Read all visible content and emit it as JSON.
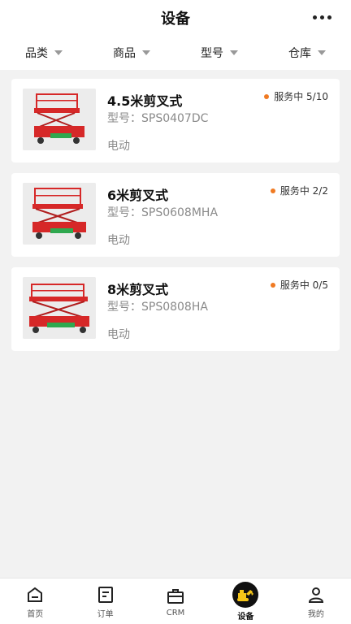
{
  "header": {
    "title": "设备"
  },
  "filters": [
    {
      "label": "品类"
    },
    {
      "label": "商品"
    },
    {
      "label": "型号"
    },
    {
      "label": "仓库"
    }
  ],
  "items": [
    {
      "name": "4.5米剪叉式",
      "model": "型号：SPS0407DC",
      "power": "电动",
      "status": "服务中 5/10"
    },
    {
      "name": "6米剪叉式",
      "model": "型号：SPS0608MHA",
      "power": "电动",
      "status": "服务中 2/2"
    },
    {
      "name": "8米剪叉式",
      "model": "型号：SPS0808HA",
      "power": "电动",
      "status": "服务中 0/5"
    }
  ],
  "tabs": [
    {
      "label": "首页",
      "icon": "home-icon"
    },
    {
      "label": "订单",
      "icon": "order-icon"
    },
    {
      "label": "CRM",
      "icon": "briefcase-icon"
    },
    {
      "label": "设备",
      "icon": "excavator-icon"
    },
    {
      "label": "我的",
      "icon": "user-icon"
    }
  ],
  "colors": {
    "status_dot": "#f07a22",
    "active_tab_bg": "#111111",
    "active_tab_icon": "#f5c518",
    "machine_red": "#d62828",
    "machine_green": "#2fa84f"
  }
}
